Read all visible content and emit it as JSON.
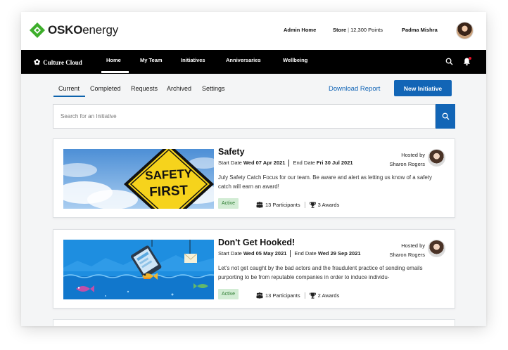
{
  "brand": {
    "logo_part1": "OSKO",
    "logo_part2": "energy",
    "colors": {
      "green": "#3dae2b",
      "blue": "#1265b6",
      "nav": "#000000"
    }
  },
  "topbar": {
    "admin_home": "Admin Home",
    "store_label": "Store",
    "store_points": "12,300 Points",
    "user_name": "Padma Mishra"
  },
  "nav": {
    "app_name": "Culture Cloud",
    "items": [
      "Home",
      "My Team",
      "Initiatives",
      "Anniversaries",
      "Wellbeing"
    ],
    "active": "Home"
  },
  "subtabs": {
    "items": [
      "Current",
      "Completed",
      "Requests",
      "Archived",
      "Settings"
    ],
    "active": "Current",
    "download_report": "Download Report",
    "new_initiative": "New Initiative"
  },
  "search": {
    "placeholder": "Search for an Initiative"
  },
  "initiatives": [
    {
      "title": "Safety",
      "start_label": "Start Date",
      "start_date": "Wed 07 Apr 2021",
      "end_label": "End Date",
      "end_date": "Fri 30 Jul 2021",
      "hosted_by_label": "Hosted by",
      "host": "Sharon Rogers",
      "description": "July Safety Catch Focus for our team. Be aware and alert as letting us know of a safety catch will earn an award!",
      "status": "Active",
      "participants": "13 Participants",
      "awards": "3 Awards",
      "sign_line1": "SAFETY",
      "sign_line2": "FIRST"
    },
    {
      "title": "Don't Get Hooked!",
      "start_label": "Start Date",
      "start_date": "Wed 05 May 2021",
      "end_label": "End Date",
      "end_date": "Wed 29 Sep 2021",
      "hosted_by_label": "Hosted by",
      "host": "Sharon Rogers",
      "description": "Let's not get caught by the bad actors and the fraudulent practice of sending emails purporting to be from reputable companies in order to induce individu-",
      "status": "Active",
      "participants": "13 Participants",
      "awards": "2 Awards"
    }
  ]
}
